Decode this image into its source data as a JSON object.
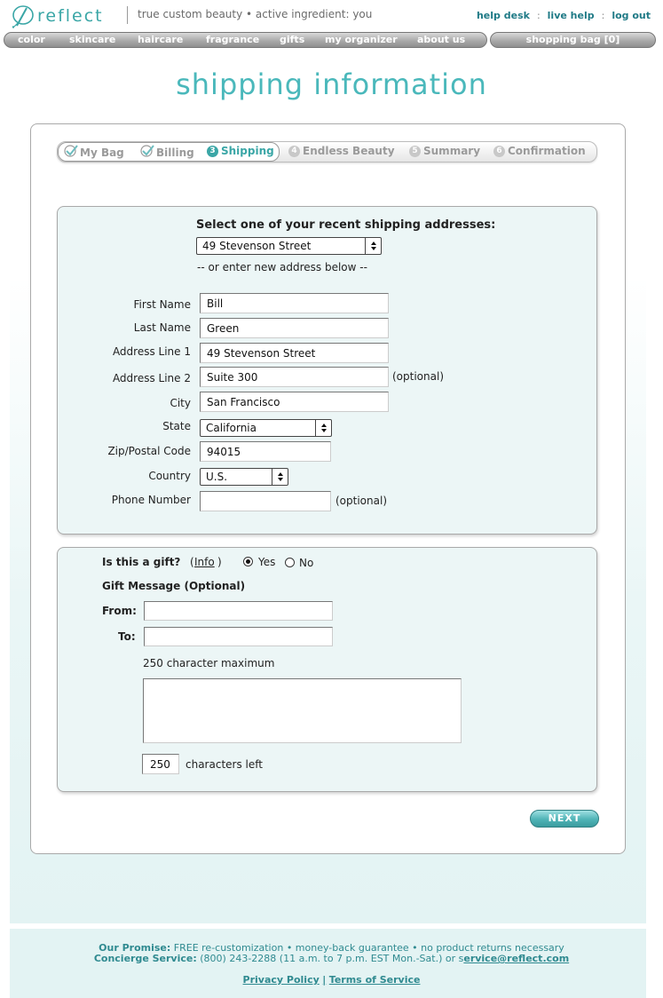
{
  "header": {
    "logo_text": "reflect",
    "tagline": "true custom beauty • active ingredient: you",
    "links": [
      "help desk",
      "live help",
      "log out"
    ],
    "separator": ":"
  },
  "nav": {
    "items": [
      "color",
      "skincare",
      "haircare",
      "fragrance",
      "gifts",
      "my organizer",
      "about us"
    ],
    "bag": "shopping bag [0]"
  },
  "page_title": "shipping information",
  "steps": [
    {
      "label": "My Bag",
      "state": "done"
    },
    {
      "label": "Billing",
      "state": "done"
    },
    {
      "num": "3",
      "label": "Shipping",
      "state": "active"
    },
    {
      "num": "4",
      "label": "Endless Beauty",
      "state": "todo"
    },
    {
      "num": "5",
      "label": "Summary",
      "state": "todo"
    },
    {
      "num": "6",
      "label": "Confirmation",
      "state": "todo"
    }
  ],
  "address": {
    "recent_prompt": "Select one of your recent shipping addresses:",
    "recent_selected": "49 Stevenson Street",
    "or_text": "-- or enter new address below --",
    "fields": {
      "first_name": {
        "label": "First Name",
        "value": "Bill"
      },
      "last_name": {
        "label": "Last Name",
        "value": "Green"
      },
      "address1": {
        "label": "Address Line 1",
        "value": "49 Stevenson Street"
      },
      "address2": {
        "label": "Address Line 2",
        "value": "Suite 300",
        "note": "(optional)"
      },
      "city": {
        "label": "City",
        "value": "San Francisco"
      },
      "state": {
        "label": "State",
        "value": "California"
      },
      "zip": {
        "label": "Zip/Postal Code",
        "value": "94015"
      },
      "country": {
        "label": "Country",
        "value": "U.S."
      },
      "phone": {
        "label": "Phone Number",
        "value": "",
        "note": "(optional)"
      }
    }
  },
  "gift": {
    "question": "Is this a gift?",
    "info_open": "(",
    "info_link": "Info",
    "info_close": ")",
    "yes_label": "Yes",
    "no_label": "No",
    "selected": "yes",
    "message_heading": "Gift Message (Optional)",
    "from_label": "From:",
    "from_value": "",
    "to_label": "To:",
    "to_value": "",
    "max_text": "250 character maximum",
    "message_value": "",
    "chars_left_value": "250",
    "chars_left_label": "characters left"
  },
  "next_button": "NEXT",
  "footer": {
    "promise_label": "Our Promise:",
    "promise_text": "FREE re-customization • money-back guarantee • no product returns necessary",
    "concierge_label": "Concierge Service:",
    "concierge_text": "(800) 243-2288 (11 a.m. to 7 p.m. EST Mon.-Sat.) or s",
    "concierge_email": "ervice@reflect.com",
    "privacy": "Privacy Policy",
    "divider": "|",
    "terms": "Terms of Service"
  },
  "colors": {
    "accent": "#3aa6a6",
    "panel": "#ecf6f6",
    "footer": "#e3f3f3"
  }
}
